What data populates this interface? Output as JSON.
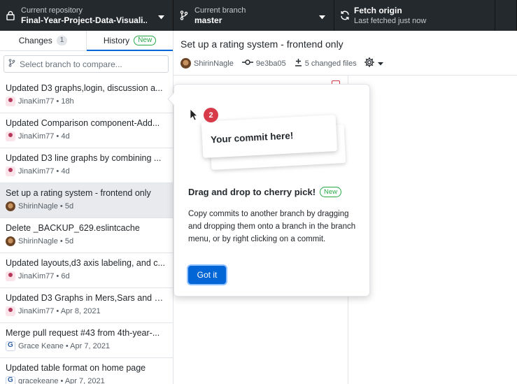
{
  "toolbar": {
    "repository": {
      "label": "Current repository",
      "value": "Final-Year-Project-Data-Visuali..."
    },
    "branch": {
      "label": "Current branch",
      "value": "master"
    },
    "fetch": {
      "label": "Fetch origin",
      "value": "Last fetched just now"
    }
  },
  "tabs": {
    "changes": {
      "label": "Changes",
      "count": "1"
    },
    "history": {
      "label": "History",
      "badge": "New"
    }
  },
  "branch_filter": {
    "placeholder": "Select branch to compare..."
  },
  "commits": [
    {
      "summary": "Updated D3 graphs,login, discussion a...",
      "meta": "JinaKim77 • 18h",
      "avatar": "jina"
    },
    {
      "summary": "Updated Comparison component-Add...",
      "meta": "JinaKim77 • 4d",
      "avatar": "jina"
    },
    {
      "summary": "Updated D3 line graphs by combining ...",
      "meta": "JinaKim77 • 4d",
      "avatar": "jina"
    },
    {
      "summary": "Set up a rating system - frontend only",
      "meta": "ShirinNagle • 5d",
      "avatar": "shirin",
      "selected": true
    },
    {
      "summary": "Delete _BACKUP_629.eslintcache",
      "meta": "ShirinNagle • 5d",
      "avatar": "shirin"
    },
    {
      "summary": "Updated layouts,d3 axis labeling, and c...",
      "meta": "JinaKim77 • 6d",
      "avatar": "jina"
    },
    {
      "summary": "Updated D3 Graphs in Mers,Sars and C...",
      "meta": "JinaKim77 • Apr 8, 2021",
      "avatar": "jina"
    },
    {
      "summary": "Merge pull request #43 from 4th-year-...",
      "meta": "Grace Keane • Apr 7, 2021",
      "avatar": "grace"
    },
    {
      "summary": "Updated table format on home page",
      "meta": "gracekeane • Apr 7, 2021",
      "avatar": "grace"
    }
  ],
  "commit_detail": {
    "title": "Set up a rating system - frontend only",
    "author": "ShirinNagle",
    "sha": "9e3ba05",
    "changed_files": "5 changed files"
  },
  "popover": {
    "step_number": "2",
    "card_text": "Your commit here!",
    "heading": "Drag and drop to cherry pick!",
    "badge": "New",
    "body": "Copy commits to another branch by dragging and dropping them onto a branch in the branch menu, or by right clicking on a commit.",
    "button": "Got it"
  },
  "colors": {
    "toolbar_bg": "#24292e",
    "accent": "#0366d6",
    "new_badge": "#28a745",
    "danger": "#d73a49"
  }
}
